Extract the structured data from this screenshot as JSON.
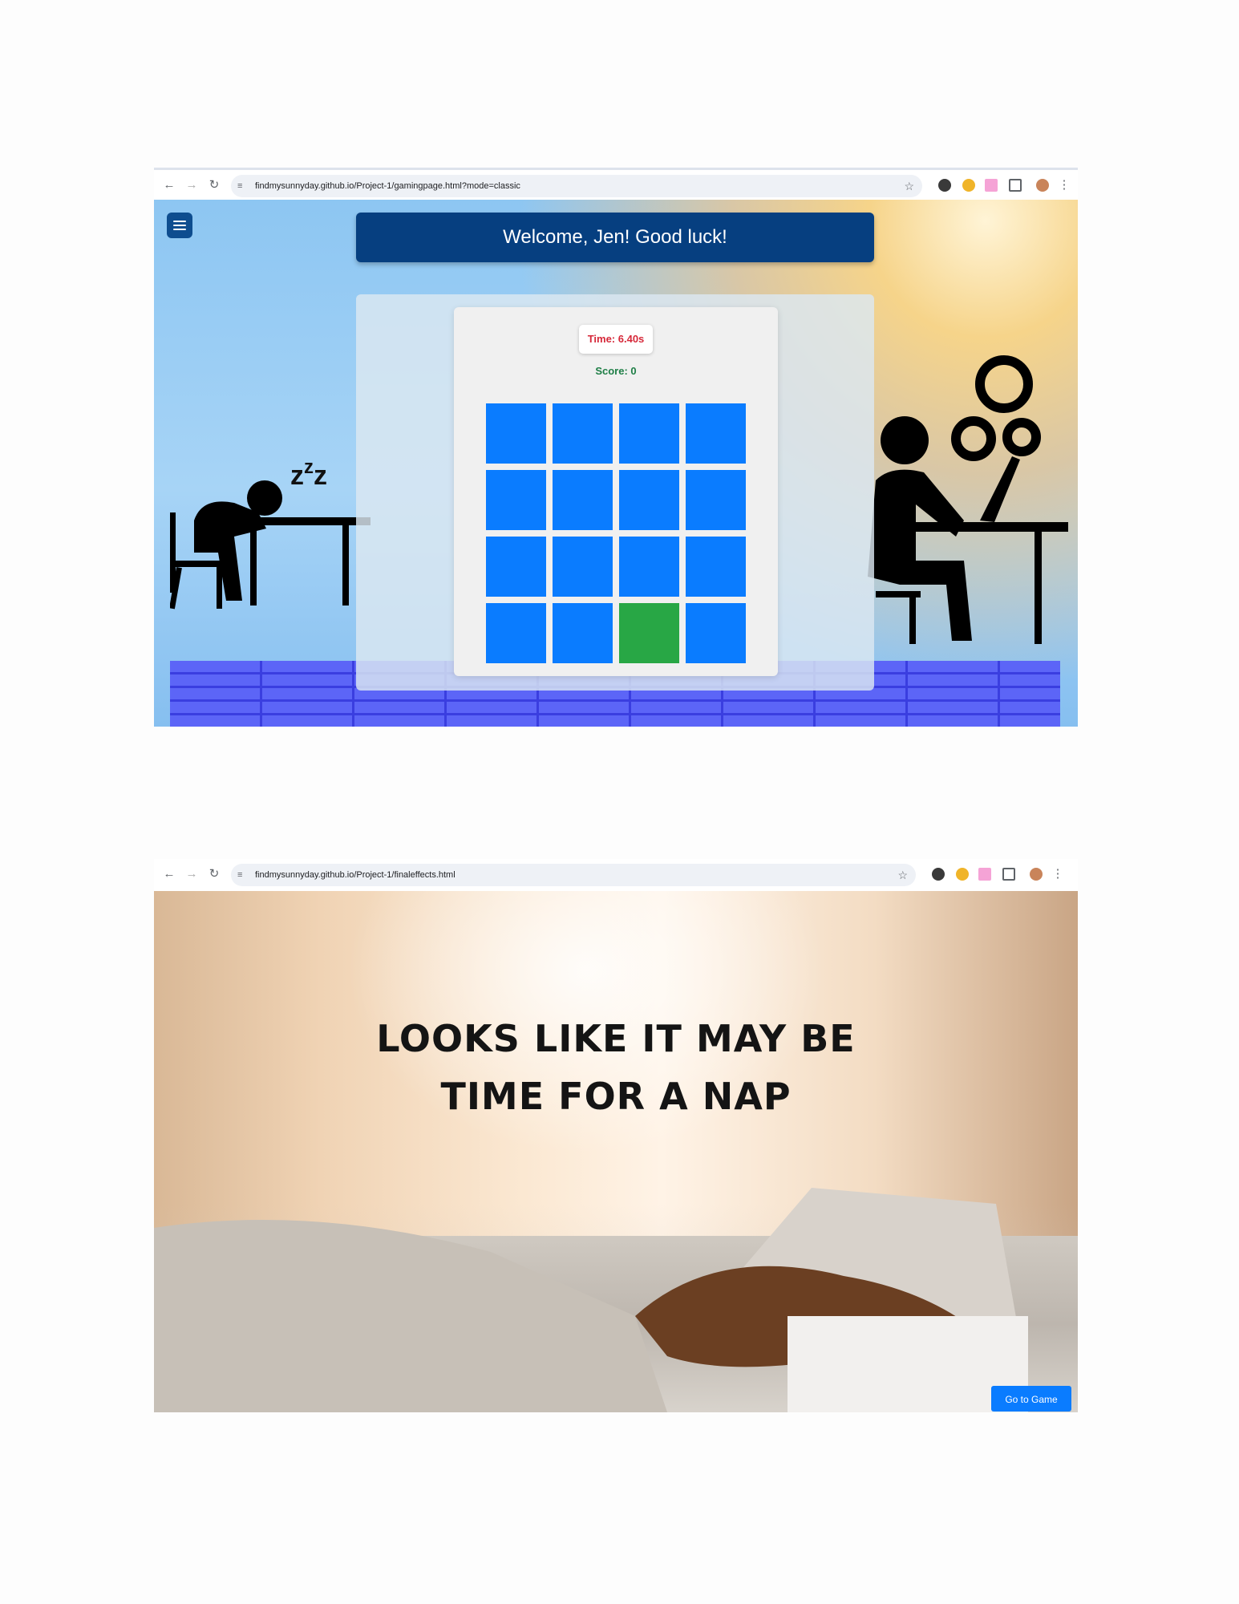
{
  "screenshot_1": {
    "browser": {
      "url": "findmysunnyday.github.io/Project-1/gamingpage.html?mode=classic"
    },
    "page": {
      "welcome_banner": "Welcome, Jen! Good luck!",
      "timer_text": "Time: 6.40s",
      "score_text": "Score: 0",
      "grid": {
        "rows": 4,
        "cols": 4,
        "card_color": "#0a7cff",
        "matched_color": "#28a745",
        "cards": [
          "hidden",
          "hidden",
          "hidden",
          "hidden",
          "hidden",
          "hidden",
          "hidden",
          "hidden",
          "hidden",
          "hidden",
          "hidden",
          "hidden",
          "hidden",
          "hidden",
          "matched",
          "hidden"
        ]
      },
      "icons": [
        "menu-icon",
        "sleeping-person-icon",
        "zzz-icon",
        "working-person-icon",
        "gears-icon"
      ]
    }
  },
  "screenshot_2": {
    "browser": {
      "url": "findmysunnyday.github.io/Project-1/finaleffects.html"
    },
    "page": {
      "headline_line1": "LOOKS LIKE IT MAY BE",
      "headline_line2": "TIME FOR A NAP",
      "go_button": "Go to Game"
    }
  },
  "colors": {
    "banner": "#063f80",
    "menu_button": "#0e4d8f",
    "timer_text": "#d62839",
    "score_text": "#1e7e46",
    "go_button": "#0a7cff"
  }
}
